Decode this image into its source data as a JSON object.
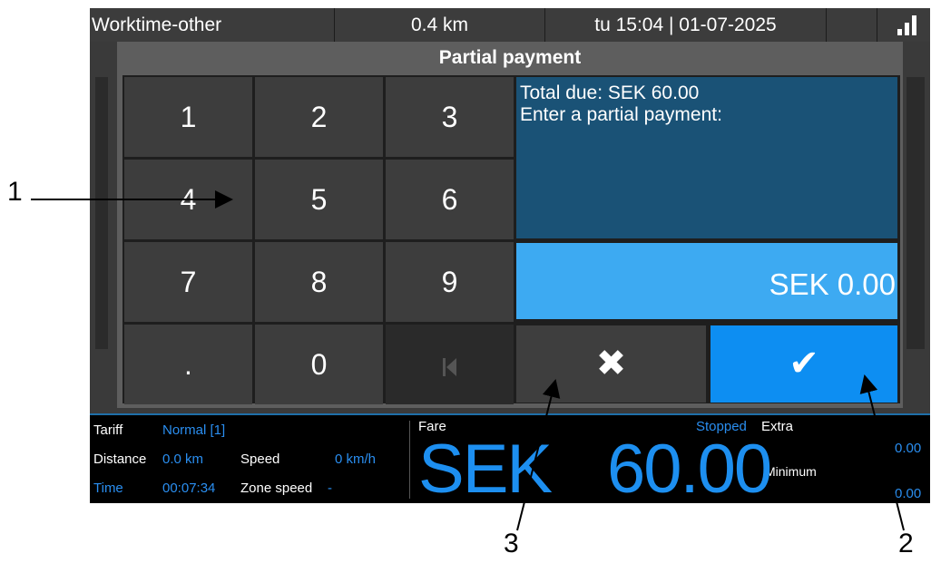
{
  "status_bar": {
    "mode": "Worktime-other",
    "distance": "0.4 km",
    "datetime": "tu 15:04 | 01-07-2025",
    "signal_icon": "signal-bars-icon"
  },
  "dialog": {
    "title": "Partial payment",
    "info_line1": "Total due: SEK 60.00",
    "info_line2": "Enter a partial payment:",
    "amount": "SEK 0.00",
    "keys": [
      "1",
      "2",
      "3",
      "4",
      "5",
      "6",
      "7",
      "8",
      "9",
      ".",
      "0"
    ],
    "cancel_icon": "✖",
    "confirm_icon": "✔"
  },
  "meter": {
    "tariff_label": "Tariff",
    "tariff_value": "Normal [1]",
    "distance_label": "Distance",
    "distance_value": "0.0 km",
    "speed_label": "Speed",
    "speed_value": "0 km/h",
    "time_label": "Time",
    "time_value": "00:07:34",
    "zone_speed_label": "Zone speed",
    "zone_speed_value": "-",
    "fare_label": "Fare",
    "status": "Stopped",
    "currency": "SEK",
    "fare_amount": "60.00",
    "extra_label": "Extra",
    "extra_value": "0.00",
    "minimum_label": "Minimum",
    "minimum_value": "0.00"
  },
  "annotations": {
    "one": "1",
    "two": "2",
    "three": "3"
  },
  "colors": {
    "accent_blue": "#0d8ef2",
    "amount_blue": "#3daaf2",
    "info_blue": "#1a5276",
    "meter_text_blue": "#2a8ef0"
  }
}
